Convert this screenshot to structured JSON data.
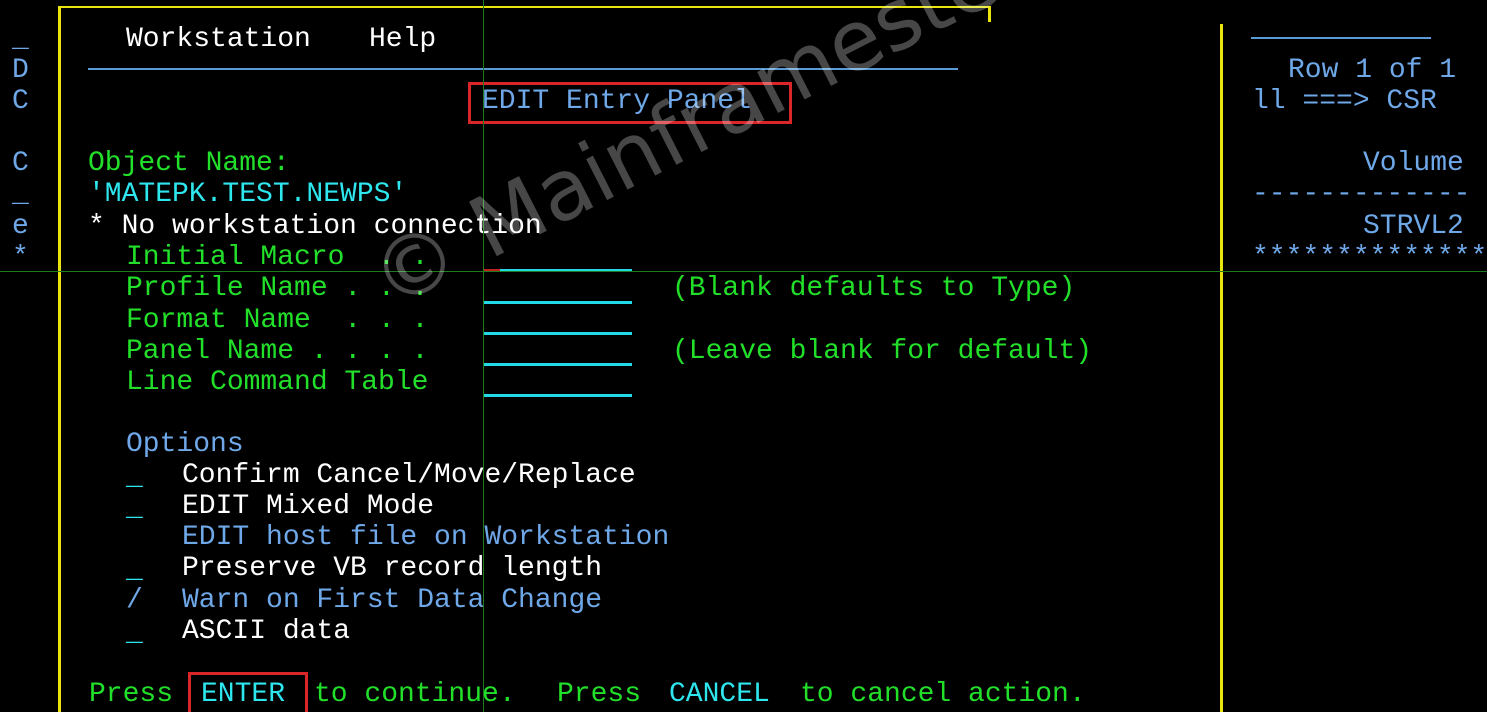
{
  "background_panel": {
    "left_column_chars": [
      "_",
      "D",
      "C",
      "",
      "C",
      "_",
      "e",
      "*"
    ],
    "right": {
      "row_info": "Row 1 of 1",
      "scroll": "ll ===> CSR",
      "volume_header": "Volume",
      "dash_line": "-------------",
      "volume_value": "STRVL2",
      "star_line": "**************"
    }
  },
  "popup": {
    "menu_bar": {
      "items": [
        "Workstation",
        "Help"
      ]
    },
    "title": "EDIT Entry Panel",
    "object_name_label": "Object Name:",
    "object_name_value": "'MATEPK.TEST.NEWPS'",
    "message": "* No workstation connection",
    "fields": [
      {
        "label": "Initial Macro  . .",
        "value": "",
        "hint": ""
      },
      {
        "label": "Profile Name . . .",
        "value": "",
        "hint": "(Blank defaults to Type)"
      },
      {
        "label": "Format Name  . . .",
        "value": "",
        "hint": ""
      },
      {
        "label": "Panel Name . . . .",
        "value": "",
        "hint": "(Leave blank for default)"
      },
      {
        "label": "Line Command Table",
        "value": "",
        "hint": ""
      }
    ],
    "options_header": "Options",
    "options": [
      {
        "mark": "_",
        "label": "Confirm Cancel/Move/Replace",
        "selected": false,
        "available": true
      },
      {
        "mark": "_",
        "label": "EDIT Mixed Mode",
        "selected": false,
        "available": true
      },
      {
        "mark": "",
        "label": "EDIT host file on Workstation",
        "selected": false,
        "available": false
      },
      {
        "mark": "_",
        "label": "Preserve VB record length",
        "selected": false,
        "available": true
      },
      {
        "mark": "/",
        "label": "Warn on First Data Change",
        "selected": true,
        "available": true
      },
      {
        "mark": "_",
        "label": "ASCII data",
        "selected": false,
        "available": true
      }
    ],
    "footer": {
      "press1": "Press",
      "enter": "ENTER",
      "continue": "to continue.",
      "press2": "Press",
      "cancel": "CANCEL",
      "cancel_action": "to cancel action."
    }
  },
  "watermark": "© Mainframestechhelp",
  "colors": {
    "background": "#000000",
    "label_green": "#22e02a",
    "text_white": "#ffffff",
    "text_blue": "#6fa8e8",
    "input_cyan": "#2ee6ee",
    "border_yellow": "#e8e40c",
    "highlight_red": "#d8262a"
  }
}
